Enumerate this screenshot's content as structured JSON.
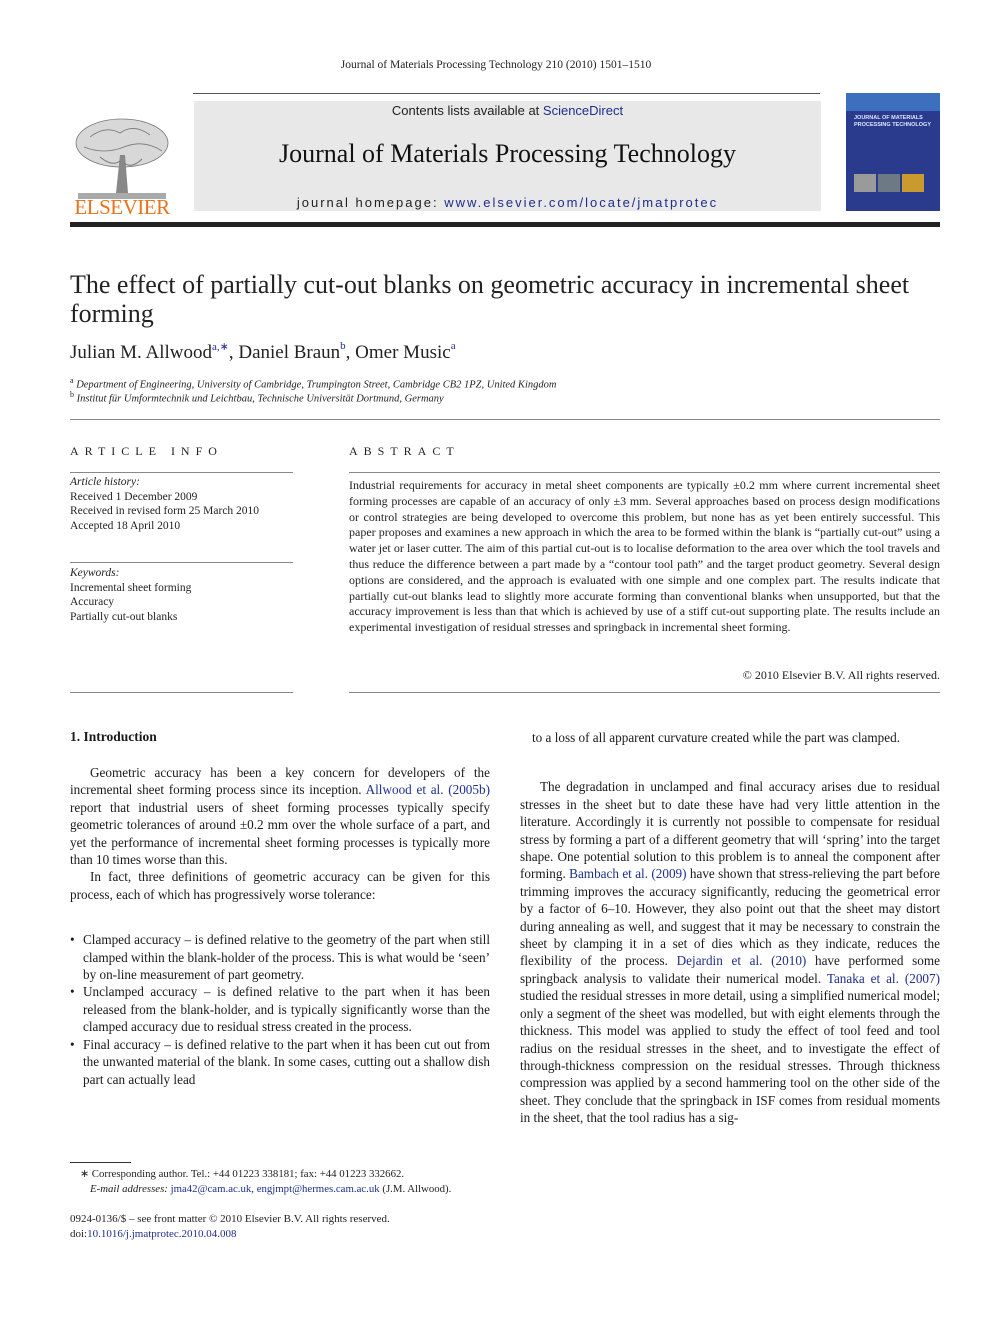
{
  "header": {
    "running_head": "Journal of Materials Processing Technology 210 (2010) 1501–1510",
    "contents_prefix": "Contents lists available at ",
    "contents_link": "ScienceDirect",
    "journal_title": "Journal of Materials Processing Technology",
    "homepage_prefix": "journal homepage: ",
    "homepage_link": "www.elsevier.com/locate/jmatprotec",
    "publisher_logo_text": "ELSEVIER",
    "cover_title": "JOURNAL OF MATERIALS PROCESSING TECHNOLOGY",
    "colors": {
      "elsevier_orange": "#e8731c",
      "link_blue": "#1f2e8c",
      "banner_gray": "#e8e8e8",
      "cover_blue": "#2a3a8c"
    }
  },
  "article": {
    "title": "The effect of partially cut-out blanks on geometric accuracy in incremental sheet forming",
    "authors": [
      {
        "name": "Julian M. Allwood",
        "sup": "a,∗"
      },
      {
        "name": "Daniel Braun",
        "sup": "b"
      },
      {
        "name": "Omer Music",
        "sup": "a"
      }
    ],
    "affiliations": [
      {
        "mark": "a",
        "text": "Department of Engineering, University of Cambridge, Trumpington Street, Cambridge CB2 1PZ, United Kingdom"
      },
      {
        "mark": "b",
        "text": "Institut für Umformtechnik und Leichtbau, Technische Universität Dortmund, Germany"
      }
    ]
  },
  "article_info": {
    "heading": "ARTICLE INFO",
    "history_label": "Article history:",
    "history": [
      "Received 1 December 2009",
      "Received in revised form 25 March 2010",
      "Accepted 18 April 2010"
    ],
    "keywords_label": "Keywords:",
    "keywords": [
      "Incremental sheet forming",
      "Accuracy",
      "Partially cut-out blanks"
    ]
  },
  "abstract": {
    "heading": "ABSTRACT",
    "text": "Industrial requirements for accuracy in metal sheet components are typically ±0.2 mm where current incremental sheet forming processes are capable of an accuracy of only ±3 mm. Several approaches based on process design modifications or control strategies are being developed to overcome this problem, but none has as yet been entirely successful. This paper proposes and examines a new approach in which the area to be formed within the blank is “partially cut-out” using a water jet or laser cutter. The aim of this partial cut-out is to localise deformation to the area over which the tool travels and thus reduce the difference between a part made by a “contour tool path” and the target product geometry. Several design options are considered, and the approach is evaluated with one simple and one complex part. The results indicate that partially cut-out blanks lead to slightly more accurate forming than conventional blanks when unsupported, but that the accuracy improvement is less than that which is achieved by use of a stiff cut-out supporting plate. The results include an experimental investigation of residual stresses and springback in incremental sheet forming.",
    "copyright": "© 2010 Elsevier B.V. All rights reserved."
  },
  "intro": {
    "heading": "1.  Introduction",
    "p1_a": "Geometric accuracy has been a key concern for developers of the incremental sheet forming process since its inception. ",
    "p1_link": "Allwood et al. (2005b)",
    "p1_b": " report that industrial users of sheet forming processes typically specify geometric tolerances of around ±0.2 mm over the whole surface of a part, and yet the performance of incremental sheet forming processes is typically more than 10 times worse than this.",
    "p2": "In fact, three definitions of geometric accuracy can be given for this process, each of which has progressively worse tolerance:",
    "bullets": [
      "Clamped accuracy – is defined relative to the geometry of the part when still clamped within the blank-holder of the process. This is what would be ‘seen’ by on-line measurement of part geometry.",
      "Unclamped accuracy – is defined relative to the part when it has been released from the blank-holder, and is typically significantly worse than the clamped accuracy due to residual stress created in the process.",
      "Final accuracy – is defined relative to the part when it has been cut out from the unwanted material of the blank. In some cases, cutting out a shallow dish part can actually lead"
    ],
    "right_cont": "to a loss of all apparent curvature created while the part was clamped.",
    "p3_a": "The degradation in unclamped and final accuracy arises due to residual stresses in the sheet but to date these have had very little attention in the literature. Accordingly it is currently not possible to compensate for residual stress by forming a part of a different geometry that will ‘spring’ into the target shape. One potential solution to this problem is to anneal the component after forming. ",
    "p3_link1": "Bambach et al. (2009)",
    "p3_b": " have shown that stress-relieving the part before trimming improves the accuracy significantly, reducing the geometrical error by a factor of 6–10. However, they also point out that the sheet may distort during annealing as well, and suggest that it may be necessary to constrain the sheet by clamping it in a set of dies which as they indicate, reduces the flexibility of the process. ",
    "p3_link2": "Dejardin et al. (2010)",
    "p3_c": " have performed some springback analysis to validate their numerical model. ",
    "p3_link3": "Tanaka et al. (2007)",
    "p3_d": " studied the residual stresses in more detail, using a simplified numerical model; only a segment of the sheet was modelled, but with eight elements through the thickness. This model was applied to study the effect of tool feed and tool radius on the residual stresses in the sheet, and to investigate the effect of through-thickness compression on the residual stresses. Through thickness compression was applied by a second hammering tool on the other side of the sheet. They conclude that the springback in ISF comes from residual moments in the sheet, that the tool radius has a sig-"
  },
  "footnote": {
    "mark": "∗",
    "corresponding": "Corresponding author. Tel.: +44 01223 338181; fax: +44 01223 332662.",
    "email_label": "E-mail addresses:",
    "email1": "jma42@cam.ac.uk",
    "email2": "engjmpt@hermes.cam.ac.uk",
    "email_suffix": "(J.M. Allwood)."
  },
  "footer": {
    "issn": "0924-0136/$ – see front matter © 2010 Elsevier B.V. All rights reserved.",
    "doi_prefix": "doi:",
    "doi": "10.1016/j.jmatprotec.2010.04.008"
  }
}
